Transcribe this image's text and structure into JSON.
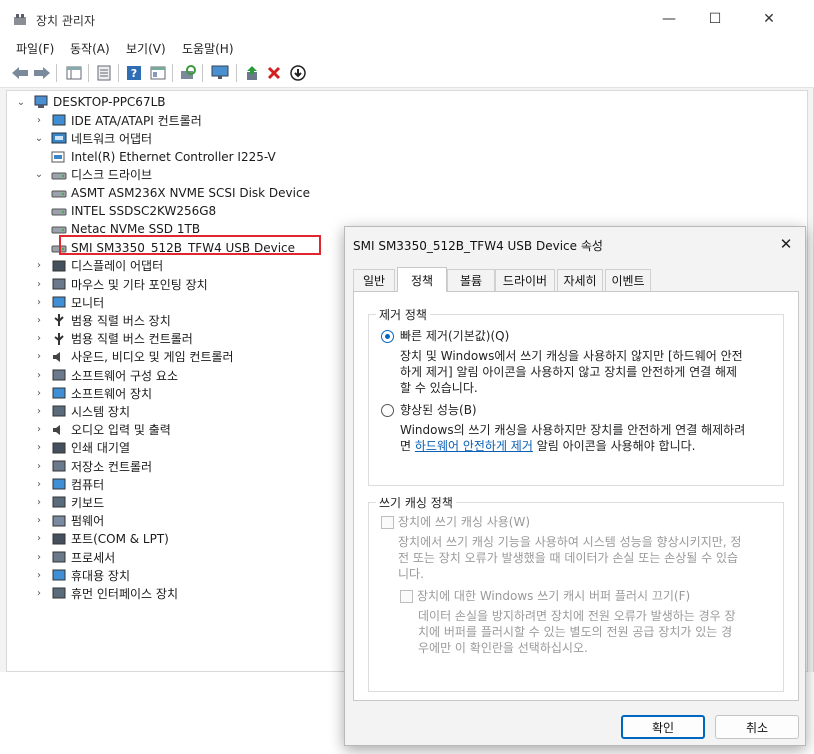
{
  "window": {
    "title": "장치 관리자",
    "controls": {
      "minimize": "—",
      "maximize": "☐",
      "close": "✕"
    }
  },
  "menu": [
    "파일(F)",
    "동작(A)",
    "보기(V)",
    "도움말(H)"
  ],
  "toolbar_icons": [
    "back-arrow-icon",
    "forward-arrow-icon",
    "properties-grid-icon",
    "list-view-icon",
    "help-icon",
    "details-icon",
    "scan-hardware-icon",
    "monitor-icon",
    "update-driver-icon",
    "uninstall-x-icon",
    "disable-download-icon"
  ],
  "tree": {
    "root": "DESKTOP-PPC67LB",
    "nodes": [
      {
        "label": "IDE ATA/ATAPI 컨트롤러",
        "expanded": false,
        "icon": "ide-icon"
      },
      {
        "label": "네트워크 어댑터",
        "expanded": true,
        "icon": "network-icon",
        "children": [
          "Intel(R) Ethernet Controller I225-V"
        ]
      },
      {
        "label": "디스크 드라이브",
        "expanded": true,
        "icon": "disk-icon",
        "children": [
          "ASMT ASM236X NVME SCSI Disk Device",
          "INTEL SSDSC2KW256G8",
          "Netac NVMe SSD 1TB",
          "SMI SM3350_512B_TFW4 USB Device"
        ]
      },
      {
        "label": "디스플레이 어댑터",
        "icon": "display-icon"
      },
      {
        "label": "마우스 및 기타 포인팅 장치",
        "icon": "mouse-icon"
      },
      {
        "label": "모니터",
        "icon": "monitor-icon"
      },
      {
        "label": "범용 직렬 버스 장치",
        "icon": "usb-icon"
      },
      {
        "label": "범용 직렬 버스 컨트롤러",
        "icon": "usb-icon"
      },
      {
        "label": "사운드, 비디오 및 게임 컨트롤러",
        "icon": "speaker-icon"
      },
      {
        "label": "소프트웨어 구성 요소",
        "icon": "software-component-icon"
      },
      {
        "label": "소프트웨어 장치",
        "icon": "software-device-icon"
      },
      {
        "label": "시스템 장치",
        "icon": "system-icon"
      },
      {
        "label": "오디오 입력 및 출력",
        "icon": "speaker-icon"
      },
      {
        "label": "인쇄 대기열",
        "icon": "printer-icon"
      },
      {
        "label": "저장소 컨트롤러",
        "icon": "storage-icon"
      },
      {
        "label": "컴퓨터",
        "icon": "computer-icon"
      },
      {
        "label": "키보드",
        "icon": "keyboard-icon"
      },
      {
        "label": "펌웨어",
        "icon": "firmware-icon"
      },
      {
        "label": "포트(COM & LPT)",
        "icon": "port-icon"
      },
      {
        "label": "프로세서",
        "icon": "processor-icon"
      },
      {
        "label": "휴대용 장치",
        "icon": "portable-icon"
      },
      {
        "label": "휴먼 인터페이스 장치",
        "icon": "hid-icon"
      }
    ],
    "highlight_color": "#e0262e"
  },
  "dialog": {
    "title": "SMI SM3350_512B_TFW4 USB Device 속성",
    "close": "✕",
    "tabs": [
      "일반",
      "정책",
      "볼륨",
      "드라이버",
      "자세히",
      "이벤트"
    ],
    "active_tab": "정책",
    "removal": {
      "group": "제거 정책",
      "quick": "빠른 제거(기본값)(Q)",
      "quick_desc": [
        "장치 및 Windows에서 쓰기 캐싱을 사용하지 않지만 [하드웨어 안전",
        "하게 제거] 알림 아이콘을 사용하지 않고 장치를 안전하게 연결 해제",
        "할 수 있습니다."
      ],
      "better": "향상된 성능(B)",
      "better_desc1": "Windows의 쓰기 캐싱을 사용하지만 장치를 안전하게 연결 해제하려",
      "better_desc2_pre": "면 ",
      "better_link": "하드웨어 안전하게 제거",
      "better_desc2_post": " 알림 아이콘을 사용해야 합니다."
    },
    "write_cache": {
      "group": "쓰기 캐싱 정책",
      "enable": "장치에 쓰기 캐싱 사용(W)",
      "enable_desc": [
        "장치에서 쓰기 캐싱 기능을 사용하여 시스템 성능을 향상시키지만, 정",
        "전 또는 장치 오류가 발생했을 때 데이터가 손실 또는 손상될 수 있습",
        "니다."
      ],
      "flush": "장치에 대한 Windows 쓰기 캐시 버퍼 플러시 끄기(F)",
      "flush_desc": [
        "데이터 손실을 방지하려면 장치에 전원 오류가 발생하는 경우 장",
        "치에 버퍼를 플러시할 수 있는 별도의 전원 공급 장치가 있는 경",
        "우에만 이 확인란을 선택하십시오."
      ]
    },
    "ok": "확인",
    "cancel": "취소",
    "accent": "#0067c0"
  }
}
